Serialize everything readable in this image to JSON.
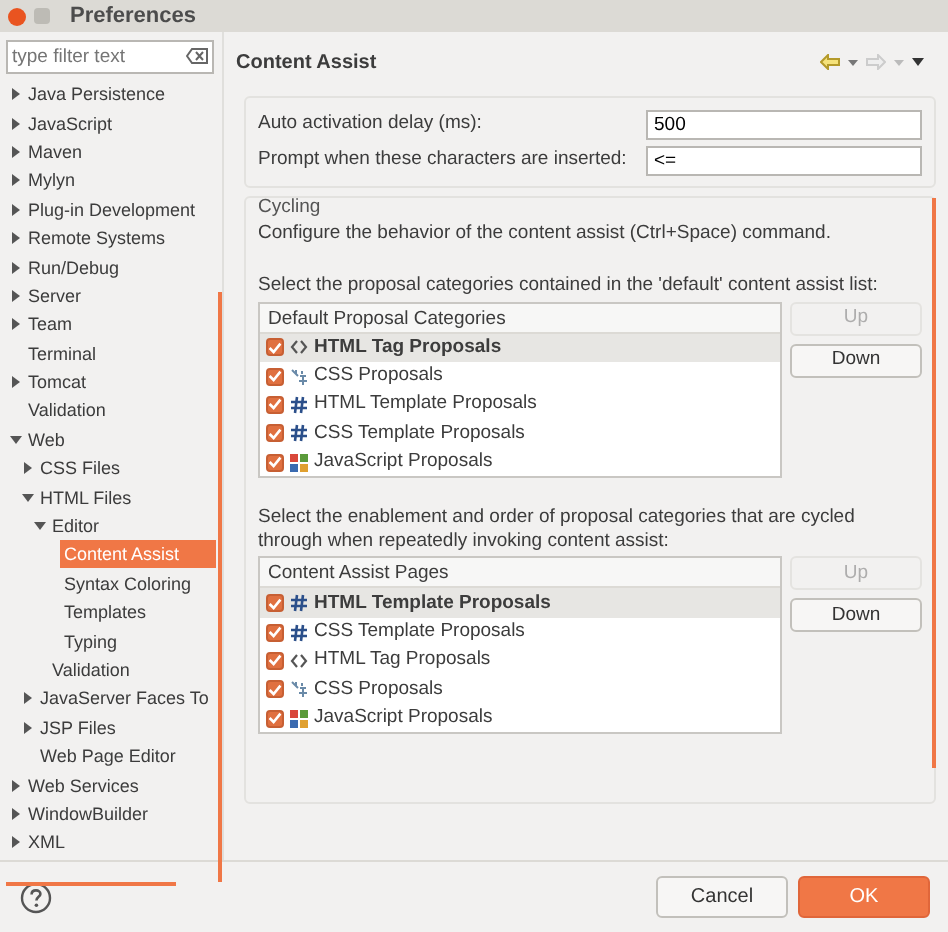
{
  "window": {
    "title": "Preferences"
  },
  "filter": {
    "placeholder": "type filter text"
  },
  "tree": [
    {
      "label": "Java Persistence",
      "expanded": false,
      "selected": false
    },
    {
      "label": "JavaScript",
      "expanded": false,
      "selected": false
    },
    {
      "label": "Maven",
      "expanded": false,
      "selected": false
    },
    {
      "label": "Mylyn",
      "expanded": false,
      "selected": false
    },
    {
      "label": "Plug-in Development",
      "expanded": false,
      "selected": false
    },
    {
      "label": "Remote Systems",
      "expanded": false,
      "selected": false
    },
    {
      "label": "Run/Debug",
      "expanded": false,
      "selected": false
    },
    {
      "label": "Server",
      "expanded": false,
      "selected": false
    },
    {
      "label": "Team",
      "expanded": false,
      "selected": false
    },
    {
      "label": "Terminal",
      "selected": false
    },
    {
      "label": "Tomcat",
      "expanded": false,
      "selected": false
    },
    {
      "label": "Validation",
      "selected": false
    },
    {
      "label": "Web",
      "expanded": true,
      "selected": false,
      "children": [
        {
          "label": "CSS Files",
          "expanded": false,
          "selected": false
        },
        {
          "label": "HTML Files",
          "expanded": true,
          "selected": false,
          "children": [
            {
              "label": "Editor",
              "expanded": true,
              "selected": false,
              "children": [
                {
                  "label": "Content Assist",
                  "selected": true
                },
                {
                  "label": "Syntax Coloring",
                  "selected": false
                },
                {
                  "label": "Templates",
                  "selected": false
                },
                {
                  "label": "Typing",
                  "selected": false
                }
              ]
            },
            {
              "label": "Validation",
              "selected": false
            }
          ]
        },
        {
          "label": "JavaServer Faces To",
          "expanded": false,
          "selected": false
        },
        {
          "label": "JSP Files",
          "expanded": false,
          "selected": false
        },
        {
          "label": "Web Page Editor",
          "selected": false
        }
      ]
    },
    {
      "label": "Web Services",
      "expanded": false,
      "selected": false
    },
    {
      "label": "WindowBuilder",
      "expanded": false,
      "selected": false
    },
    {
      "label": "XML",
      "expanded": false,
      "selected": false
    }
  ],
  "page": {
    "title": "Content Assist",
    "fields": [
      {
        "label": "Auto activation delay (ms):",
        "value": "500"
      },
      {
        "label": "Prompt when these characters are inserted:",
        "value": "<="
      }
    ],
    "cycling": {
      "title": "Cycling",
      "description": "Configure the behavior of the content assist (Ctrl+Space) command.",
      "lists": [
        {
          "caption": "Select the proposal categories contained in the 'default' content assist list:",
          "header": "Default Proposal Categories",
          "items": [
            {
              "label": "HTML Tag Proposals",
              "kind": "tag",
              "checked": true,
              "selected": true
            },
            {
              "label": "CSS Proposals",
              "kind": "css",
              "checked": true,
              "selected": false
            },
            {
              "label": "HTML Template Proposals",
              "kind": "template",
              "checked": true,
              "selected": false
            },
            {
              "label": "CSS Template Proposals",
              "kind": "template",
              "checked": true,
              "selected": false
            },
            {
              "label": "JavaScript Proposals",
              "kind": "js",
              "checked": true,
              "selected": false
            }
          ],
          "buttons": [
            {
              "label": "Up",
              "disabled": true
            },
            {
              "label": "Down",
              "disabled": false
            }
          ]
        },
        {
          "caption": "Select the enablement and order of proposal categories that are cycled through when repeatedly invoking content assist:",
          "header": "Content Assist Pages",
          "items": [
            {
              "label": "HTML Template Proposals",
              "kind": "template",
              "checked": true,
              "selected": true
            },
            {
              "label": "CSS Template Proposals",
              "kind": "template",
              "checked": true,
              "selected": false
            },
            {
              "label": "HTML Tag Proposals",
              "kind": "tag",
              "checked": true,
              "selected": false
            },
            {
              "label": "CSS Proposals",
              "kind": "css",
              "checked": true,
              "selected": false
            },
            {
              "label": "JavaScript Proposals",
              "kind": "js",
              "checked": true,
              "selected": false
            }
          ],
          "buttons": [
            {
              "label": "Up",
              "disabled": true
            },
            {
              "label": "Down",
              "disabled": false
            }
          ]
        }
      ]
    }
  },
  "buttons": [
    {
      "label": "Cancel",
      "kind": "secondary"
    },
    {
      "label": "OK",
      "kind": "primary"
    }
  ]
}
